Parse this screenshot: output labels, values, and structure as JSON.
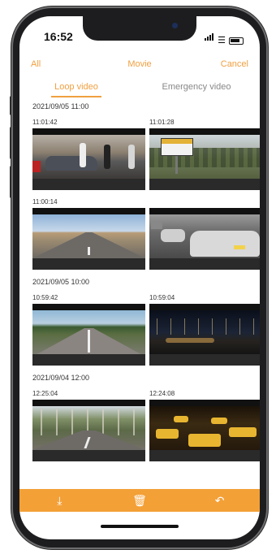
{
  "status": {
    "time": "16:52"
  },
  "header": {
    "left": "All",
    "title": "Movie",
    "right": "Cancel"
  },
  "tabs": [
    {
      "label": "Loop video",
      "active": true
    },
    {
      "label": "Emergency video",
      "active": false
    }
  ],
  "groups": [
    {
      "date": "2021/09/05 11:00",
      "items": [
        "11:01:42",
        "11:01:28",
        "11:00:14",
        ""
      ]
    },
    {
      "date": "2021/09/05 10:00",
      "items": [
        "10:59:42",
        "10:59:04"
      ]
    },
    {
      "date": "2021/09/04 12:00",
      "items": [
        "12:25:04",
        "12:24:08"
      ]
    }
  ],
  "toolbar": {
    "download_icon": "download-icon",
    "delete_icon": "trash-icon",
    "back_icon": "return-icon"
  },
  "colors": {
    "accent": "#f3a037",
    "accent_text": "#f0a040"
  }
}
